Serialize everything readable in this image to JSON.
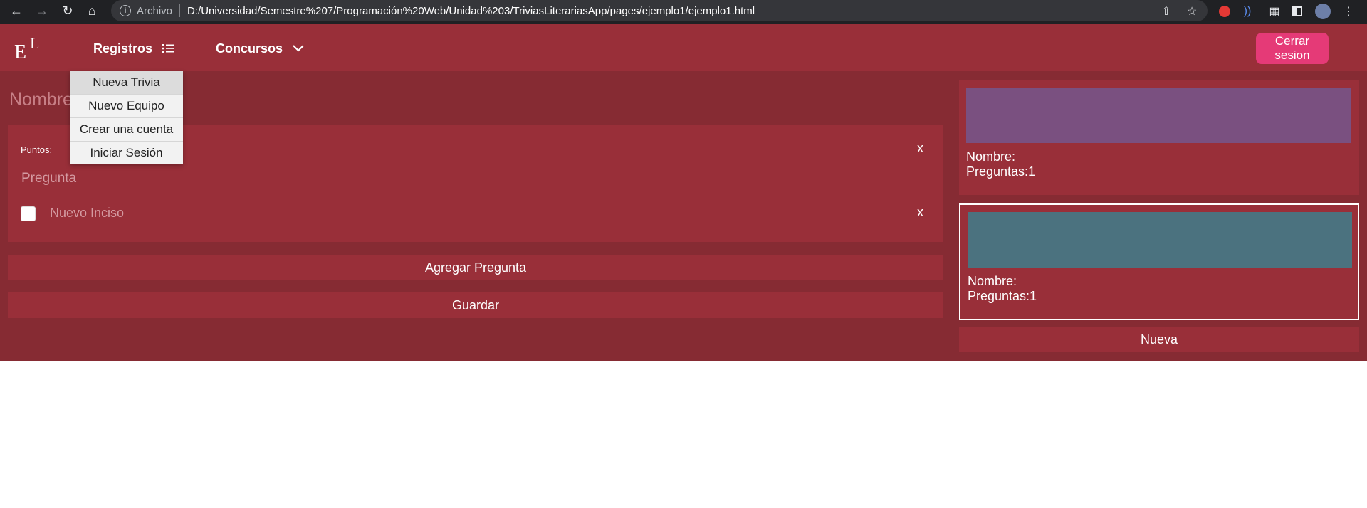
{
  "browser": {
    "scheme_label": "Archivo",
    "info_glyph": "i",
    "url": "D:/Universidad/Semestre%207/Programación%20Web/Unidad%203/TriviasLiterariasApp/pages/ejemplo1/ejemplo1.html"
  },
  "navbar": {
    "logo_e": "E",
    "logo_l": "L",
    "registros_label": "Registros",
    "concursos_label": "Concursos",
    "logout_label": "Cerrar sesion",
    "logout_color": "#e53a77"
  },
  "dropdown": {
    "items": [
      "Nueva Trivia",
      "Nuevo Equipo",
      "Crear una cuenta",
      "Iniciar Sesión"
    ]
  },
  "editor": {
    "name_placeholder": "Nombre",
    "points_label": "Puntos:",
    "question_placeholder": "Pregunta",
    "option_placeholder": "Nuevo Inciso",
    "remove_glyph": "x",
    "add_question_label": "Agregar Pregunta",
    "save_label": "Guardar"
  },
  "trivias": [
    {
      "name_label": "Nombre:",
      "questions_label": "Preguntas:1",
      "color": "#7a5080",
      "selected": false
    },
    {
      "name_label": "Nombre:",
      "questions_label": "Preguntas:1",
      "color": "#4b727f",
      "selected": true
    }
  ],
  "new_trivia_label": "Nueva",
  "colors": {
    "background": "#862b33",
    "panel": "#992f39",
    "accent": "#e53a77"
  }
}
